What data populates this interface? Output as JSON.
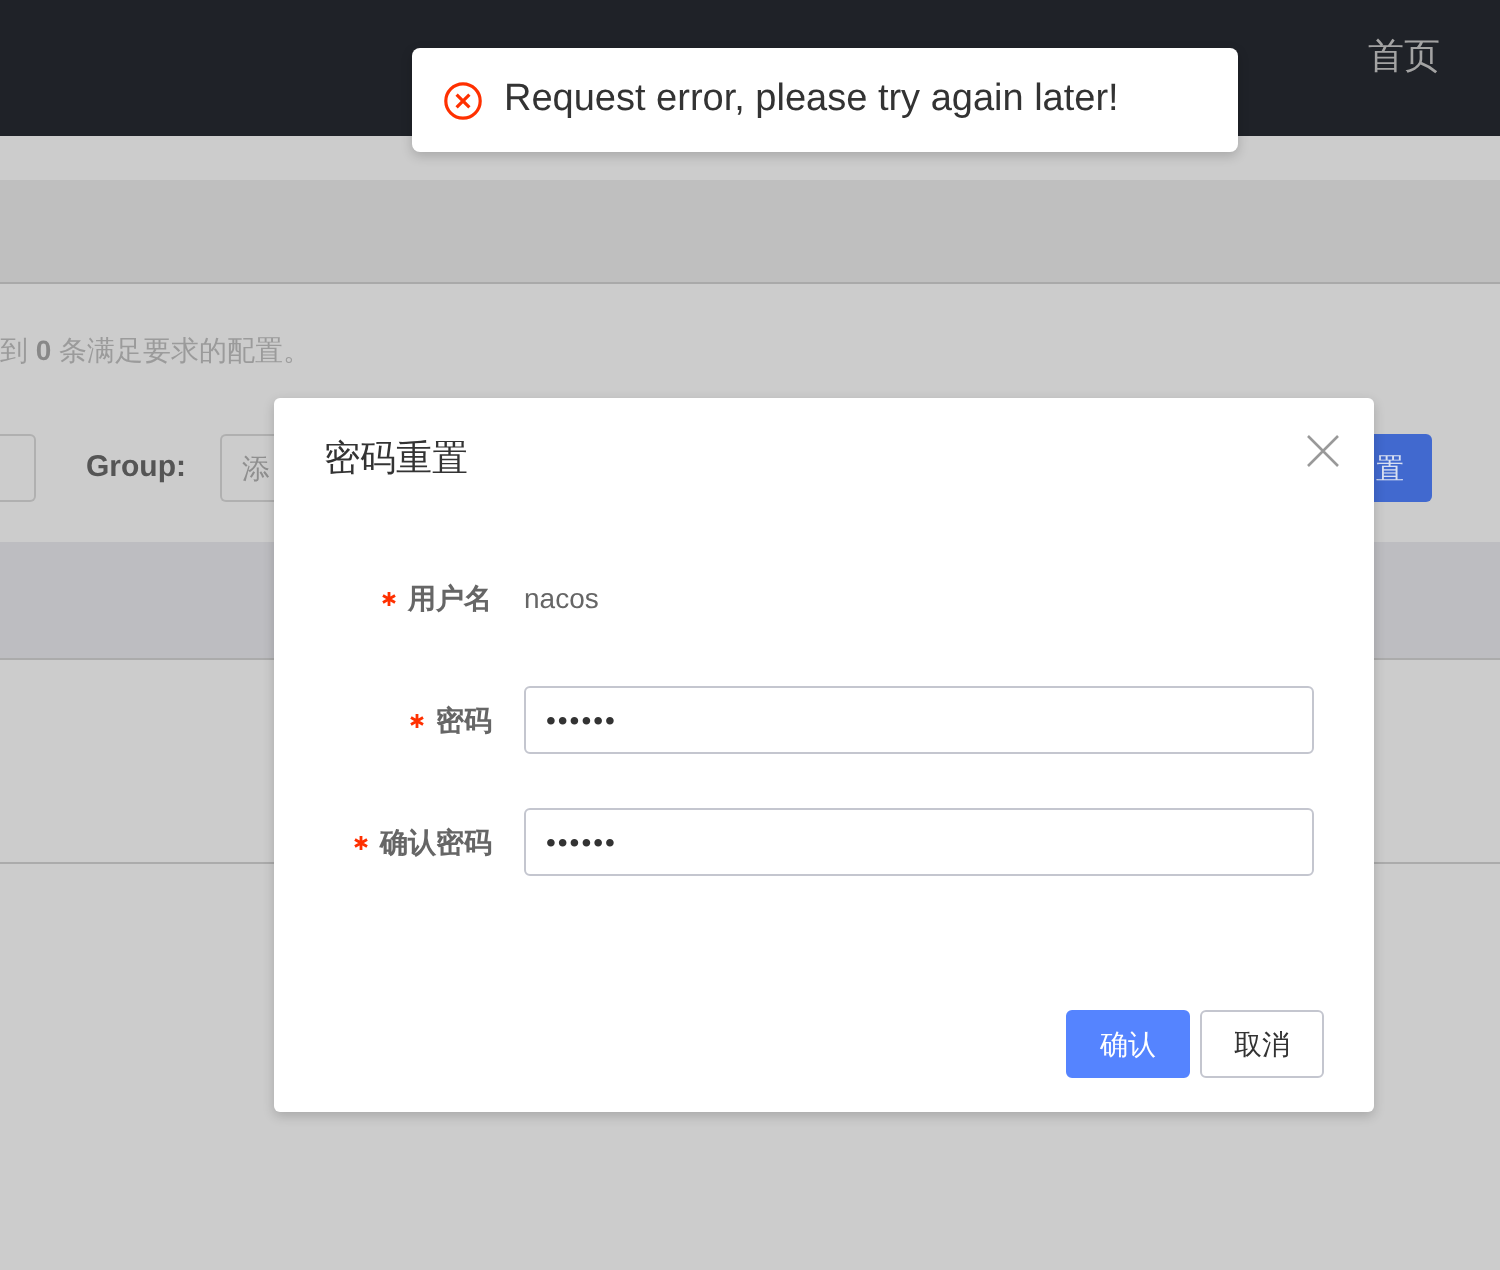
{
  "header": {
    "nav_link": "首页"
  },
  "result_summary": "到 **0** 条满足要求的配置。",
  "search": {
    "group_label": "Group:",
    "group_placeholder": "添",
    "button": "置"
  },
  "dialog": {
    "title": "密码重置",
    "fields": [
      {
        "kind": "text",
        "label": "用户名",
        "required": true,
        "value": "nacos"
      },
      {
        "kind": "input",
        "label": "密码",
        "required": true,
        "value": "••••••"
      },
      {
        "kind": "input",
        "label": "确认密码",
        "required": true,
        "value": "••••••"
      }
    ],
    "buttons": [
      {
        "kind": "primary",
        "label": "确认"
      },
      {
        "kind": "secondary",
        "label": "取消"
      }
    ]
  },
  "toast": {
    "kind": "error",
    "message": "Request error, please try again later!"
  }
}
